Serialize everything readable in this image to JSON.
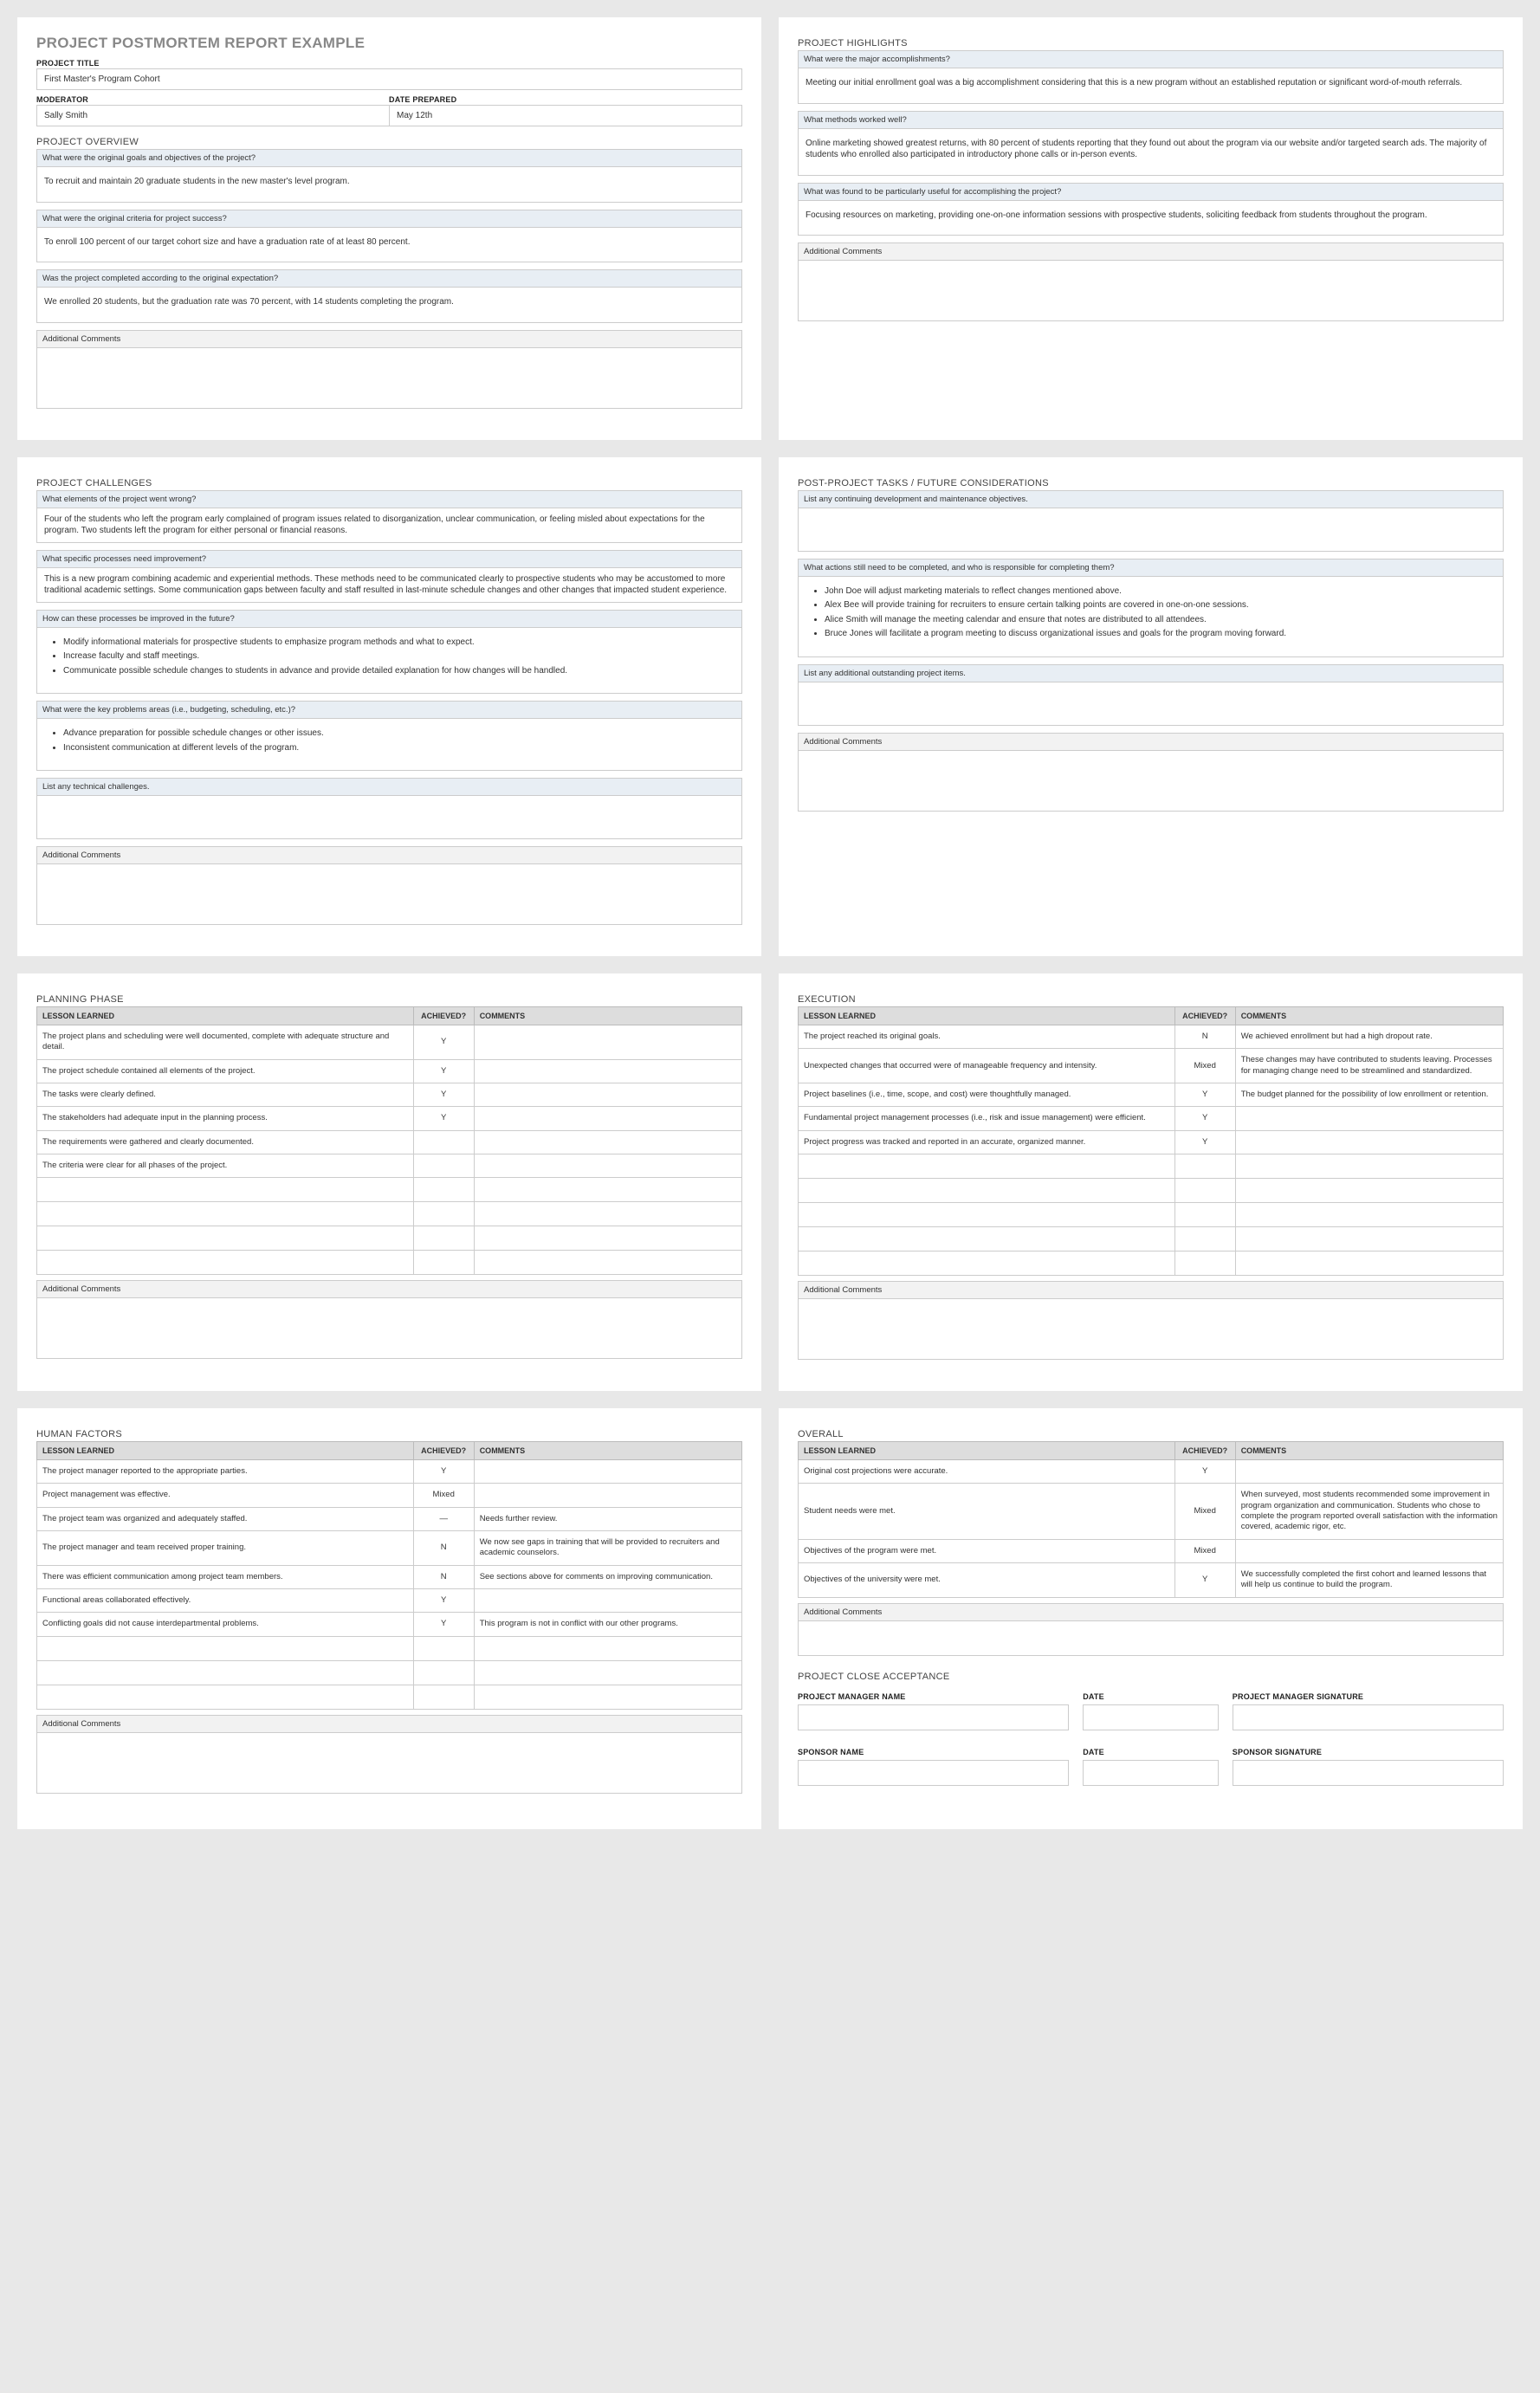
{
  "title": "PROJECT POSTMORTEM REPORT EXAMPLE",
  "labels": {
    "project_title": "PROJECT TITLE",
    "moderator": "MODERATOR",
    "date_prepared": "DATE PREPARED",
    "additional": "Additional Comments",
    "lesson": "LESSON LEARNED",
    "achieved": "ACHIEVED?",
    "comments": "COMMENTS",
    "pm_name": "PROJECT MANAGER NAME",
    "date": "DATE",
    "pm_sig": "PROJECT MANAGER SIGNATURE",
    "sp_name": "SPONSOR NAME",
    "sp_sig": "SPONSOR SIGNATURE"
  },
  "meta": {
    "project_title": "First Master's Program Cohort",
    "moderator": "Sally Smith",
    "date_prepared": "May 12th"
  },
  "overview": {
    "heading": "PROJECT OVERVIEW",
    "q1": "What were the original goals and objectives of the project?",
    "a1": "To recruit and maintain 20 graduate students in the new master's level program.",
    "q2": "What were the original criteria for project success?",
    "a2": "To enroll 100 percent of our target cohort size and have a graduation rate of at least 80 percent.",
    "q3": "Was the project completed according to the original expectation?",
    "a3": "We enrolled 20 students, but the graduation rate was 70 percent, with 14 students completing the program."
  },
  "highlights": {
    "heading": "PROJECT HIGHLIGHTS",
    "q1": "What were the major accomplishments?",
    "a1": "Meeting our initial enrollment goal was a big accomplishment considering that this is a new program without an established reputation or significant word-of-mouth referrals.",
    "q2": "What methods worked well?",
    "a2": "Online marketing showed greatest returns, with 80 percent of students reporting that they found out about the program via our website and/or targeted search ads. The majority of students who enrolled also participated in introductory phone calls or in-person events.",
    "q3": "What was found to be particularly useful for accomplishing the project?",
    "a3": "Focusing resources on marketing, providing one-on-one information sessions with prospective students, soliciting feedback from students throughout the program."
  },
  "challenges": {
    "heading": "PROJECT CHALLENGES",
    "q1": "What elements of the project went wrong?",
    "a1": "Four of the students who left the program early complained of program issues related to disorganization, unclear communication, or feeling misled  about expectations for the program. Two students left the program for either personal or financial reasons.",
    "q2": "What specific processes need improvement?",
    "a2": "This is a new program combining academic and experiential methods. These methods need to be communicated clearly to prospective students who may be accustomed to more traditional academic settings. Some communication gaps between faculty and staff resulted in last-minute schedule changes and other changes that impacted student experience.",
    "q3": "How can these processes be improved in the future?",
    "a3_items": [
      "Modify informational materials for prospective students to emphasize program methods and what to expect.",
      "Increase faculty and staff meetings.",
      "Communicate possible schedule changes to students in advance and provide detailed explanation for how changes will be handled."
    ],
    "q4": "What were the key problems areas (i.e., budgeting, scheduling, etc.)?",
    "a4_items": [
      "Advance preparation for possible schedule changes or other issues.",
      "Inconsistent communication at different levels of the program."
    ],
    "q5": "List any technical challenges."
  },
  "post": {
    "heading": "POST-PROJECT TASKS / FUTURE CONSIDERATIONS",
    "q1": "List any continuing development and maintenance objectives.",
    "q2": "What actions still need to be completed, and who is responsible for completing them?",
    "a2_items": [
      "John Doe will adjust marketing materials to reflect changes mentioned above.",
      "Alex Bee will provide training for recruiters to ensure certain talking points are covered in one-on-one sessions.",
      "Alice Smith will manage the meeting calendar and ensure that notes are distributed to all attendees.",
      "Bruce Jones will facilitate a program meeting to discuss organizational issues and goals for the program moving forward."
    ],
    "q3": "List any additional outstanding project items."
  },
  "planning": {
    "heading": "PLANNING PHASE",
    "rows": [
      {
        "l": "The project plans and scheduling were well documented, complete with adequate structure and detail.",
        "a": "Y",
        "c": ""
      },
      {
        "l": "The project schedule contained all elements of the project.",
        "a": "Y",
        "c": ""
      },
      {
        "l": "The tasks were clearly defined.",
        "a": "Y",
        "c": ""
      },
      {
        "l": "The stakeholders had adequate input in the planning process.",
        "a": "Y",
        "c": ""
      },
      {
        "l": "The requirements were gathered and clearly documented.",
        "a": "",
        "c": ""
      },
      {
        "l": "The criteria were clear for all phases of the project.",
        "a": "",
        "c": ""
      }
    ]
  },
  "execution": {
    "heading": "EXECUTION",
    "rows": [
      {
        "l": "The project reached its original goals.",
        "a": "N",
        "c": "We achieved enrollment but had a high dropout rate."
      },
      {
        "l": "Unexpected changes that occurred were of manageable frequency and intensity.",
        "a": "Mixed",
        "c": "These changes may have contributed to students leaving. Processes for managing change need to be streamlined and standardized."
      },
      {
        "l": "Project baselines (i.e., time, scope, and cost) were thoughtfully managed.",
        "a": "Y",
        "c": "The budget planned for the possibility of low enrollment or retention."
      },
      {
        "l": "Fundamental project management processes (i.e., risk and issue management) were efficient.",
        "a": "Y",
        "c": ""
      },
      {
        "l": "Project progress was tracked and reported in an accurate, organized manner.",
        "a": "Y",
        "c": ""
      }
    ]
  },
  "human": {
    "heading": "HUMAN FACTORS",
    "rows": [
      {
        "l": "The project manager reported to the appropriate parties.",
        "a": "Y",
        "c": ""
      },
      {
        "l": "Project management was effective.",
        "a": "Mixed",
        "c": ""
      },
      {
        "l": "The project team was organized and adequately staffed.",
        "a": "—",
        "c": "Needs further review."
      },
      {
        "l": "The project manager and team received proper training.",
        "a": "N",
        "c": "We now see gaps in training that will be provided to recruiters and academic counselors."
      },
      {
        "l": "There was efficient communication among project team members.",
        "a": "N",
        "c": "See sections above for comments on improving communication."
      },
      {
        "l": "Functional areas collaborated effectively.",
        "a": "Y",
        "c": ""
      },
      {
        "l": "Conflicting goals did not cause interdepartmental problems.",
        "a": "Y",
        "c": "This program is not in conflict with our other programs."
      }
    ]
  },
  "overall": {
    "heading": "OVERALL",
    "rows": [
      {
        "l": "Original cost projections were accurate.",
        "a": "Y",
        "c": ""
      },
      {
        "l": "Student needs were met.",
        "a": "Mixed",
        "c": "When surveyed, most students recommended some improvement in program organization and communication. Students who chose to complete the program reported overall satisfaction with the information covered, academic rigor, etc."
      },
      {
        "l": "Objectives of the program were met.",
        "a": "Mixed",
        "c": ""
      },
      {
        "l": "Objectives of the university were met.",
        "a": "Y",
        "c": "We successfully completed the first cohort and learned lessons that will help us continue to build the program."
      }
    ]
  },
  "close": {
    "heading": "PROJECT CLOSE ACCEPTANCE"
  }
}
